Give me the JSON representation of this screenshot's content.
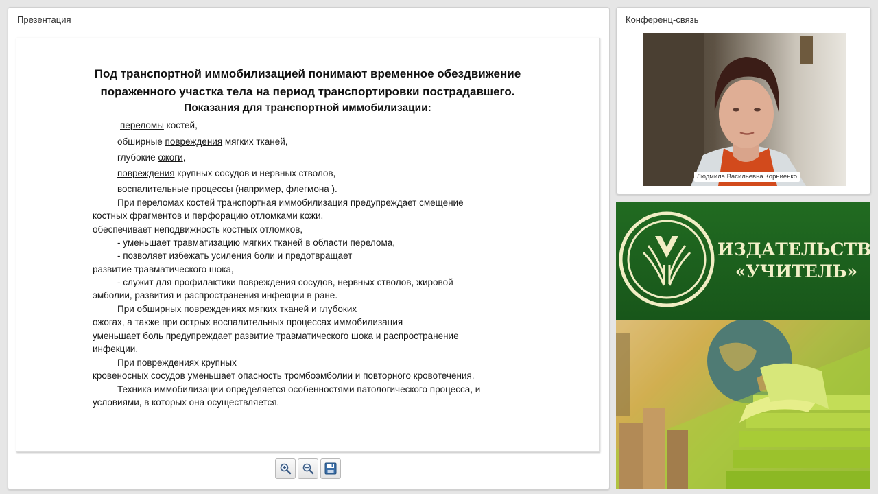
{
  "presentation": {
    "title": "Презентация",
    "slide": {
      "title_lines": [
        "Под транспортной иммобилизацией понимают временное обездвижение",
        "пораженного участка тела на период транспортировки пострадавшего.",
        "Показания для транспортной иммобилизации:"
      ],
      "list": [
        {
          "u": "переломы",
          "rest": " костей,"
        },
        {
          "pre": "обширные ",
          "u": "повреждения",
          "rest": " мягких тканей,"
        },
        {
          "pre": "глубокие ",
          "u": "ожоги",
          "rest": ","
        },
        {
          "u": "повреждения",
          "rest": " крупных сосудов и нервных стволов,"
        },
        {
          "u": "воспалительные",
          "rest": " процессы (например, флегмона )."
        }
      ],
      "body": [
        "При переломах костей  транспортная иммобилизация предупреждает  смещение",
        "костных фрагментов и перфорацию отломками кожи,",
        "обеспечивает неподвижность костных отломков,",
        "- уменьшает травматизацию мягких тканей в области перелома,",
        "- позволяет избежать усиления боли и предотвращает",
        "развитие травматического шока,",
        "- служит для профилактики повреждения  сосудов, нервных стволов, жировой",
        "эмболии, развития и распространения инфекции в ране.",
        "При обширных повреждениях мягких тканей и глубоких",
        "ожогах, а также при острых воспалительных процессах иммобилизация",
        "уменьшает боль предупреждает развитие травматического шока и распространение",
        "инфекции.",
        "При повреждениях крупных",
        "кровеносных сосудов уменьшает опасность тромбоэмболии и повторного кровотечения.",
        "Техника иммобилизации определяется особенностями патологического процесса, и",
        "условиями, в которых она осуществляется."
      ]
    },
    "toolbar": {
      "zoom_in_icon": "zoom-in-icon",
      "zoom_out_icon": "zoom-out-icon",
      "save_icon": "save-icon"
    }
  },
  "conference": {
    "title": "Конференц-связь",
    "participant_name": "Людмила Васильевна Корниенко"
  },
  "banner": {
    "line1": "ИЗДАТЕЛЬСТВО",
    "line2": "«УЧИТЕЛЬ»",
    "colors": {
      "green": "#1c5d1c",
      "cream": "#f2f0c8"
    }
  }
}
